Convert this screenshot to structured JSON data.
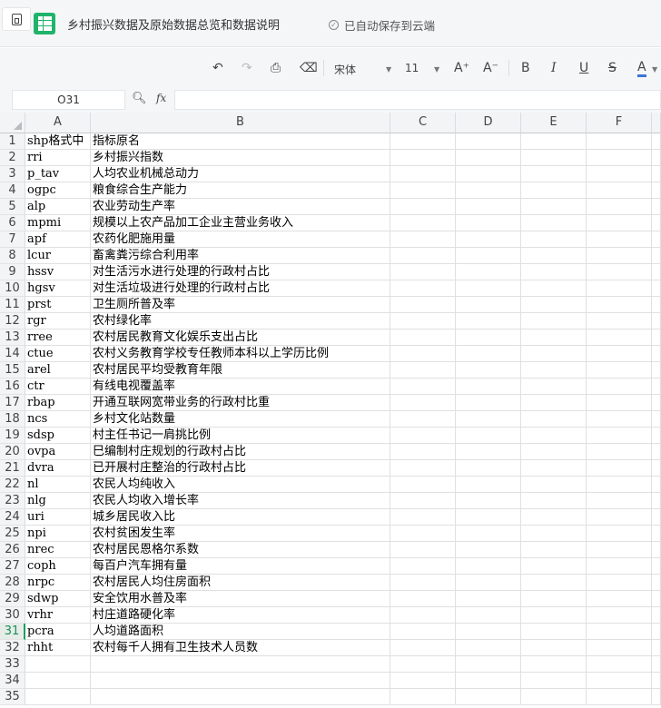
{
  "header": {
    "title": "乡村振兴数据及原始数据总览和数据说明",
    "save_status": "已自动保存到云端"
  },
  "toolbar": {
    "font_name": "宋体",
    "font_size": "11",
    "bold": "B",
    "italic": "I",
    "underline": "U",
    "strike": "S",
    "font_color": "A",
    "font_color_hex": "#3b73d9",
    "increase_font": "A⁺",
    "decrease_font": "A⁻"
  },
  "formula_bar": {
    "cell_ref": "O31",
    "fx": "fx",
    "value": ""
  },
  "accent_color": "#1f9d62",
  "sheet": {
    "columns": [
      "A",
      "B",
      "C",
      "D",
      "E",
      "F"
    ],
    "selected_row": 31,
    "rows": [
      [
        "shp格式中",
        "指标原名"
      ],
      [
        "rri",
        "乡村振兴指数"
      ],
      [
        "p_tav",
        "人均农业机械总动力"
      ],
      [
        "ogpc",
        "粮食综合生产能力"
      ],
      [
        "alp",
        "农业劳动生产率"
      ],
      [
        "mpmi",
        "规模以上农产品加工企业主营业务收入"
      ],
      [
        "apf",
        "农药化肥施用量"
      ],
      [
        "lcur",
        "畜禽粪污综合利用率"
      ],
      [
        "hssv",
        "对生活污水进行处理的行政村占比"
      ],
      [
        "hgsv",
        "对生活垃圾进行处理的行政村占比"
      ],
      [
        "prst",
        "卫生厕所普及率"
      ],
      [
        "rgr",
        "农村绿化率"
      ],
      [
        "rree",
        "农村居民教育文化娱乐支出占比"
      ],
      [
        "ctue",
        "农村义务教育学校专任教师本科以上学历比例"
      ],
      [
        "arel",
        "农村居民平均受教育年限"
      ],
      [
        "ctr",
        "有线电视覆盖率"
      ],
      [
        "rbap",
        "开通互联网宽带业务的行政村比重"
      ],
      [
        "ncs",
        "乡村文化站数量"
      ],
      [
        "sdsp",
        "村主任书记一肩挑比例"
      ],
      [
        "ovpa",
        "巳编制村庄规划的行政村占比"
      ],
      [
        "dvra",
        "已开展村庄整治的行政村占比"
      ],
      [
        "nl",
        "农民人均纯收入"
      ],
      [
        "nlg",
        "农民人均收入增长率"
      ],
      [
        "uri",
        "城乡居民收入比"
      ],
      [
        "npi",
        "农村贫困发生率"
      ],
      [
        "nrec",
        "农村居民恩格尔系数"
      ],
      [
        "coph",
        "每百户汽车拥有量"
      ],
      [
        "nrpc",
        "农村居民人均住房面积"
      ],
      [
        "sdwp",
        "安全饮用水普及率"
      ],
      [
        "vrhr",
        "村庄道路硬化率"
      ],
      [
        "pcra",
        "人均道路面积"
      ],
      [
        "rhht",
        "农村每千人拥有卫生技术人员数"
      ],
      [
        "",
        ""
      ],
      [
        "",
        ""
      ],
      [
        "",
        ""
      ]
    ]
  }
}
